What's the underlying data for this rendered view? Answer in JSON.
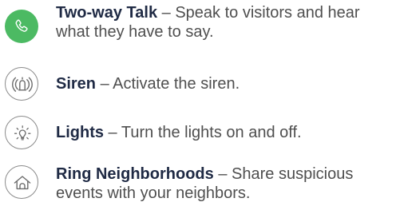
{
  "features": [
    {
      "icon": "phone-icon",
      "title": "Two-way Talk",
      "separator": " – ",
      "description": "Speak to visitors and hear what they have to say."
    },
    {
      "icon": "siren-icon",
      "title": "Siren",
      "separator": " – ",
      "description": "Activate the siren."
    },
    {
      "icon": "lightbulb-icon",
      "title": "Lights",
      "separator": " – ",
      "description": "Turn the lights on and off."
    },
    {
      "icon": "house-icon",
      "title": "Ring Neighborhoods",
      "separator": " – ",
      "description": "Share suspicious events with your neighbors."
    }
  ],
  "colors": {
    "accent_green": "#4cba63",
    "title_navy": "#1f2a44",
    "body_gray": "#4f4f4f",
    "icon_gray": "#8b8b8b"
  }
}
